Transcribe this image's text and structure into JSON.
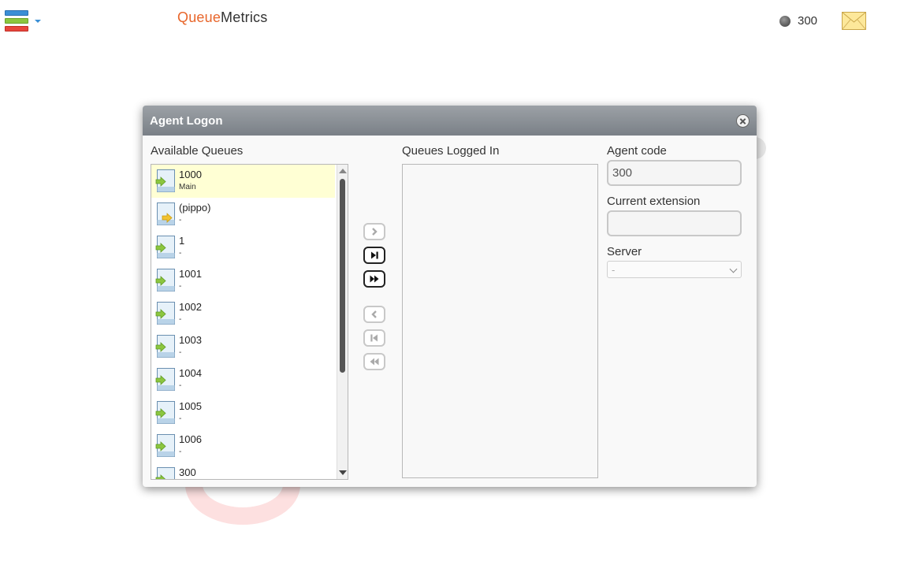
{
  "header": {
    "logo_part1": "Queue",
    "logo_part2": "Metrics",
    "agent_number": "300",
    "menu_icon": "stacked-bars-menu-icon",
    "status_icon": "status-dot-icon",
    "mail_icon": "envelope-icon"
  },
  "dialog": {
    "title": "Agent Logon",
    "available_label": "Available Queues",
    "logged_in_label": "Queues Logged In",
    "available_queues": [
      {
        "name": "1000",
        "sub": "Main",
        "selected": true,
        "icon": "green-arrow"
      },
      {
        "name": "(pippo)",
        "sub": "-",
        "selected": false,
        "icon": "yellow-arrow"
      },
      {
        "name": "1",
        "sub": "-",
        "selected": false,
        "icon": "green-arrow"
      },
      {
        "name": "1001",
        "sub": "-",
        "selected": false,
        "icon": "green-arrow"
      },
      {
        "name": "1002",
        "sub": "-",
        "selected": false,
        "icon": "green-arrow"
      },
      {
        "name": "1003",
        "sub": "-",
        "selected": false,
        "icon": "green-arrow"
      },
      {
        "name": "1004",
        "sub": "-",
        "selected": false,
        "icon": "green-arrow"
      },
      {
        "name": "1005",
        "sub": "-",
        "selected": false,
        "icon": "green-arrow"
      },
      {
        "name": "1006",
        "sub": "-",
        "selected": false,
        "icon": "green-arrow"
      },
      {
        "name": "300",
        "sub": "",
        "selected": false,
        "icon": "green-arrow"
      }
    ],
    "logged_in_queues": [],
    "agent_code_label": "Agent code",
    "agent_code_value": "300",
    "extension_label": "Current extension",
    "extension_value": "",
    "server_label": "Server",
    "server_value": "-",
    "colors": {
      "header_top": "#9ca1a6",
      "header_bottom": "#7a8087",
      "selected_row": "#ffffd4",
      "logo_accent": "#e8662b"
    }
  }
}
